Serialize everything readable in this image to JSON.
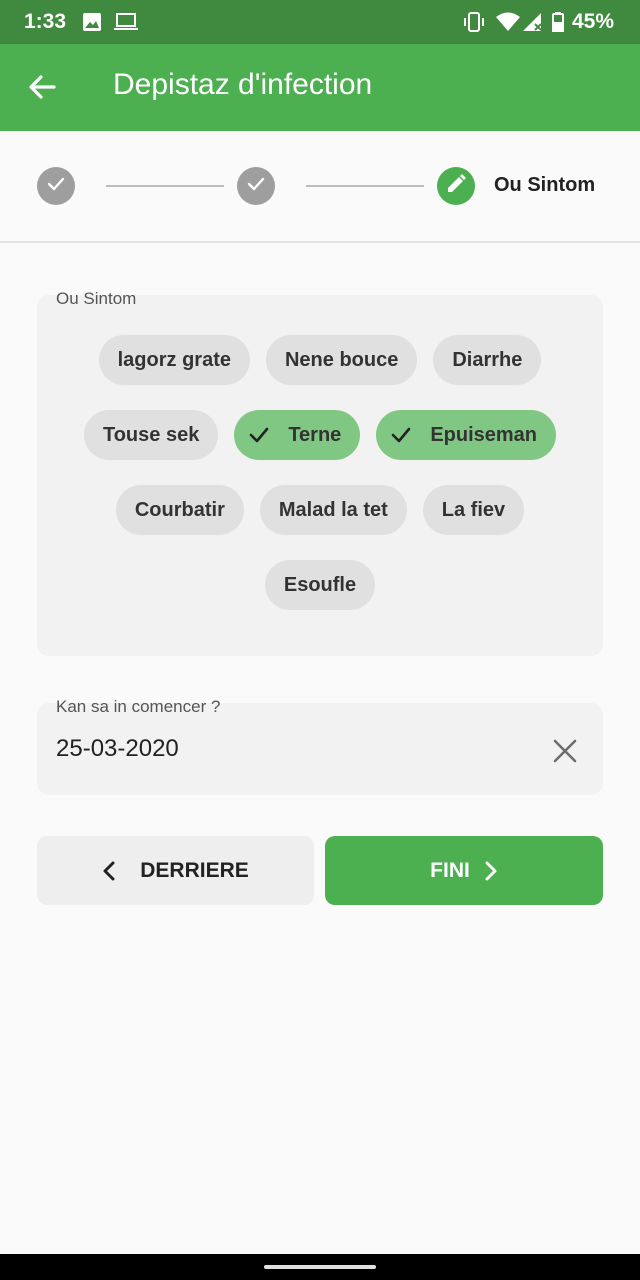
{
  "status_bar": {
    "time": "1:33",
    "battery": "45%",
    "icons": [
      "image-icon",
      "laptop-icon",
      "vibrate-icon",
      "wifi-icon",
      "signal-icon",
      "battery-icon"
    ]
  },
  "app_bar": {
    "title": "Depistaz d'infection",
    "back_icon": "arrow-back-icon"
  },
  "stepper": {
    "current_label": "Ou Sintom",
    "steps": [
      {
        "state": "done",
        "icon": "check-icon"
      },
      {
        "state": "done",
        "icon": "check-icon"
      },
      {
        "state": "active",
        "icon": "pencil-icon"
      }
    ]
  },
  "symptoms": {
    "label": "Ou Sintom",
    "chips": [
      {
        "label": "lagorz grate",
        "selected": false
      },
      {
        "label": "Nene bouce",
        "selected": false
      },
      {
        "label": "Diarrhe",
        "selected": false
      },
      {
        "label": "Touse sek",
        "selected": false
      },
      {
        "label": "Terne",
        "selected": true
      },
      {
        "label": "Epuiseman",
        "selected": true
      },
      {
        "label": "Courbatir",
        "selected": false
      },
      {
        "label": "Malad la tet",
        "selected": false
      },
      {
        "label": "La fiev",
        "selected": false
      },
      {
        "label": "Esoufle",
        "selected": false
      }
    ]
  },
  "start_date": {
    "label": "Kan sa in comencer ?",
    "value": "25-03-2020"
  },
  "buttons": {
    "back_label": "DERRIERE",
    "next_label": "FINI"
  },
  "colors": {
    "primary": "#4caf50",
    "status_bar": "#3f8a3f",
    "chip_selected": "#81c784",
    "chip_default": "#e0e0e0"
  }
}
